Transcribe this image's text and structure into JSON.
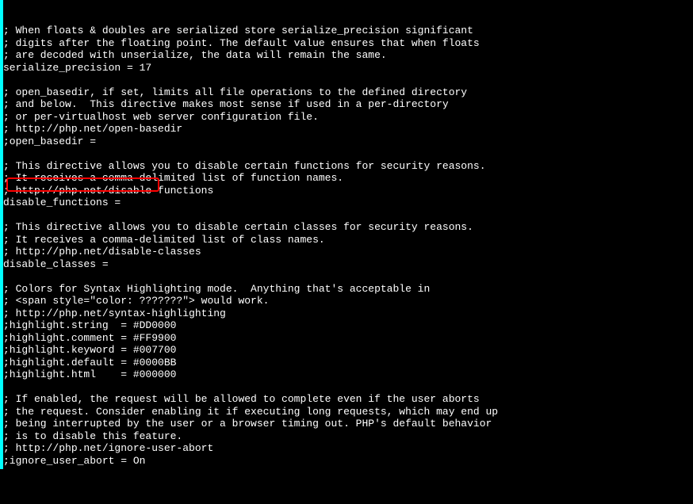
{
  "terminal": {
    "lines": [
      "; When floats & doubles are serialized store serialize_precision significant",
      "; digits after the floating point. The default value ensures that when floats",
      "; are decoded with unserialize, the data will remain the same.",
      "serialize_precision = 17",
      "",
      "; open_basedir, if set, limits all file operations to the defined directory",
      "; and below.  This directive makes most sense if used in a per-directory",
      "; or per-virtualhost web server configuration file.",
      "; http://php.net/open-basedir",
      ";open_basedir =",
      "",
      "; This directive allows you to disable certain functions for security reasons.",
      "; It receives a comma-delimited list of function names.",
      "; http://php.net/disable-functions",
      "disable_functions =",
      "",
      "; This directive allows you to disable certain classes for security reasons.",
      "; It receives a comma-delimited list of class names.",
      "; http://php.net/disable-classes",
      "disable_classes =",
      "",
      "; Colors for Syntax Highlighting mode.  Anything that's acceptable in",
      "; <span style=\"color: ???????\"> would work.",
      "; http://php.net/syntax-highlighting",
      ";highlight.string  = #DD0000",
      ";highlight.comment = #FF9900",
      ";highlight.keyword = #007700",
      ";highlight.default = #0000BB",
      ";highlight.html    = #000000",
      "",
      "; If enabled, the request will be allowed to complete even if the user aborts",
      "; the request. Consider enabling it if executing long requests, which may end up",
      "; being interrupted by the user or a browser timing out. PHP's default behavior",
      "; is to disable this feature.",
      "; http://php.net/ignore-user-abort",
      ";ignore_user_abort = On",
      ""
    ]
  },
  "highlight": {
    "target": "disable_functions ="
  }
}
